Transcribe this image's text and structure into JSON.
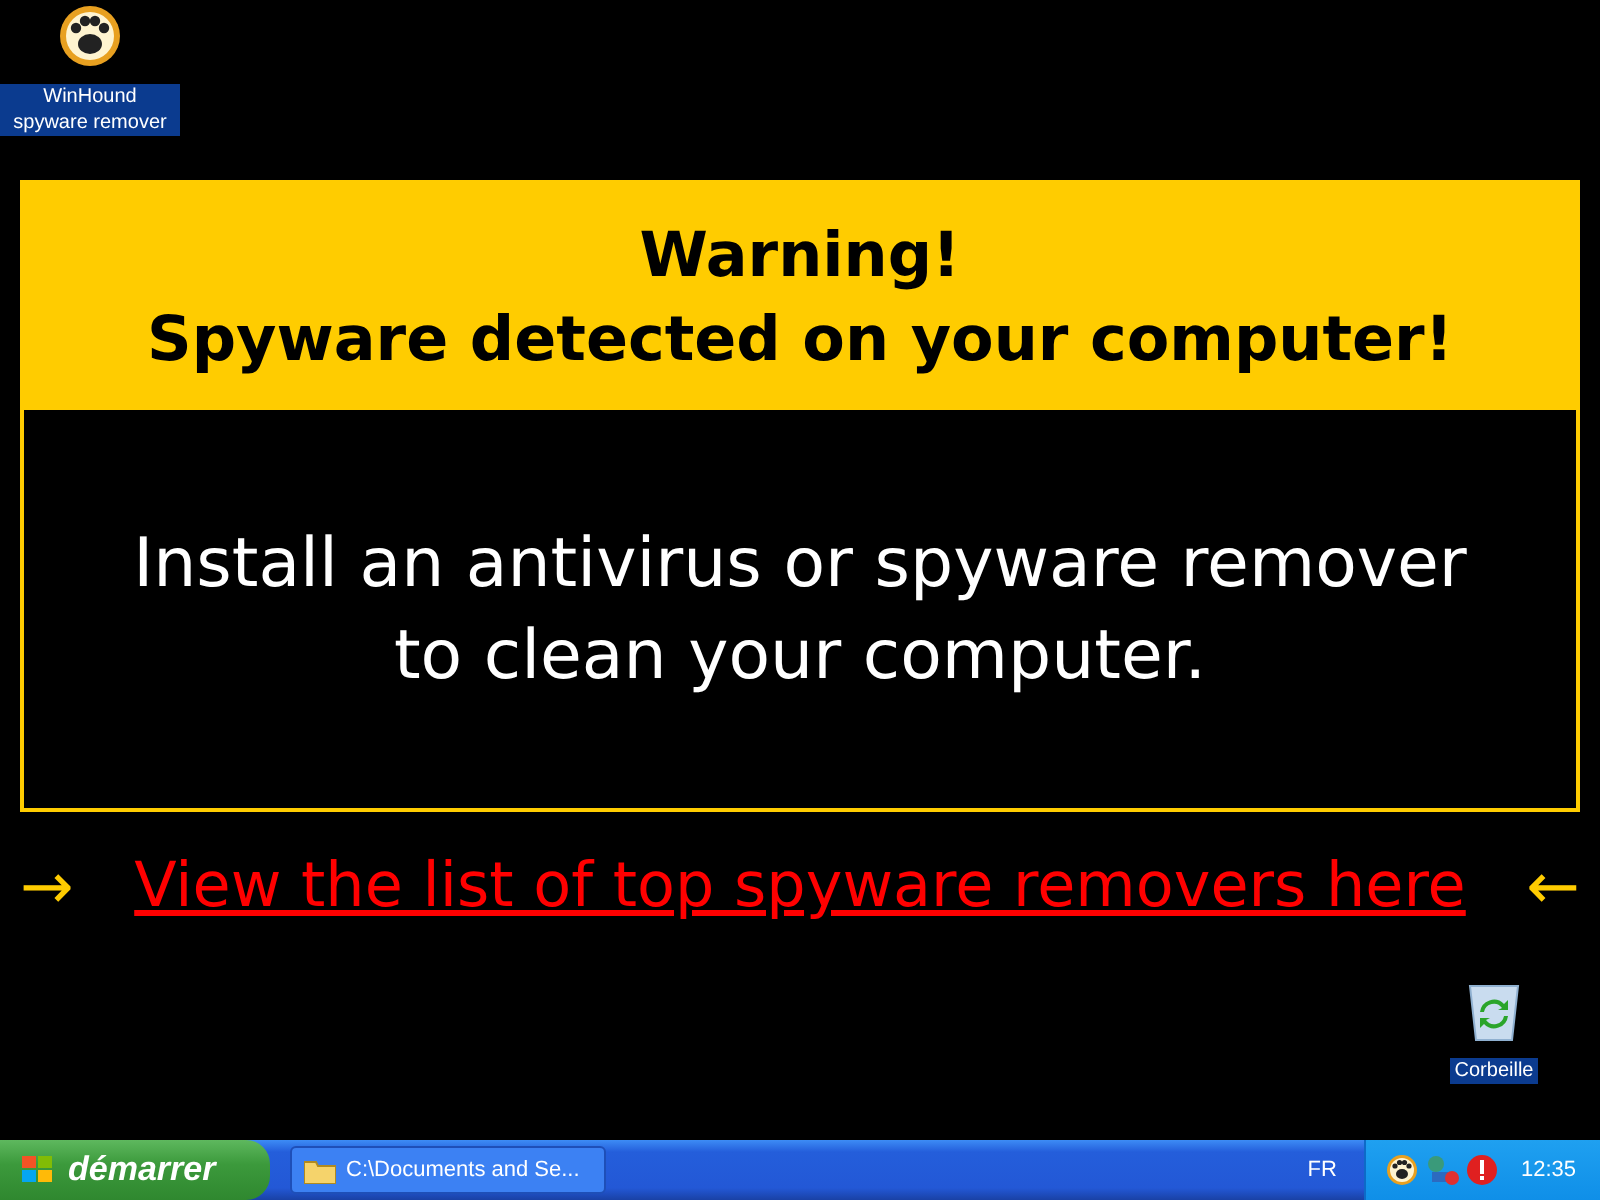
{
  "desktop_icons": [
    {
      "label": "WinHound spyware remover",
      "kind": "paw"
    },
    {
      "label": "Corbeille",
      "kind": "bin"
    }
  ],
  "warning": {
    "title": "Warning!",
    "subtitle": "Spyware detected on your computer!",
    "message": "Install an antivirus or spyware remover to clean your computer."
  },
  "link_row": {
    "left_arrow": "→",
    "link": "View the list of top spyware removers here",
    "right_arrow": "←"
  },
  "taskbar": {
    "start": "démarrer",
    "tasks": [
      {
        "label": "C:\\Documents and Se...",
        "selected": false
      }
    ],
    "language": "FR",
    "clock": "12:35"
  }
}
